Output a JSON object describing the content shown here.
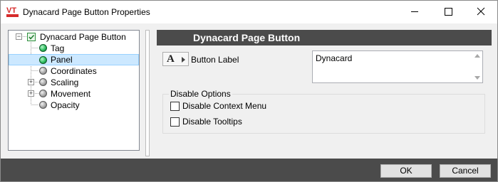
{
  "window": {
    "title": "Dynacard Page Button Properties",
    "logo_icon": "vtscada-logo-icon",
    "controls": [
      "minimize-icon",
      "maximize-icon",
      "close-icon"
    ]
  },
  "tree": {
    "root": {
      "label": "Dynacard Page Button",
      "icon": "page-button-icon",
      "expanded": true
    },
    "items": [
      {
        "label": "Tag",
        "icon": "green-ball-icon",
        "expander": false
      },
      {
        "label": "Panel",
        "icon": "green-ball-icon",
        "expander": false,
        "selected": true
      },
      {
        "label": "Coordinates",
        "icon": "gray-ball-icon",
        "expander": false
      },
      {
        "label": "Scaling",
        "icon": "gray-ball-icon",
        "expander": true
      },
      {
        "label": "Movement",
        "icon": "gray-ball-icon",
        "expander": true
      },
      {
        "label": "Opacity",
        "icon": "gray-ball-icon",
        "expander": false
      }
    ]
  },
  "panel": {
    "header": "Dynacard Page Button",
    "font_button_glyph": "A",
    "button_label": {
      "label": "Button Label",
      "value": "Dynacard"
    },
    "disable_options": {
      "title": "Disable Options",
      "options": [
        {
          "label": "Disable Context Menu",
          "checked": false
        },
        {
          "label": "Disable Tooltips",
          "checked": false
        }
      ]
    }
  },
  "footer": {
    "ok_label": "OK",
    "cancel_label": "Cancel"
  },
  "colors": {
    "header_bg": "#4b4b4b",
    "selection_bg": "#cce8ff",
    "node_active": "#2fbf62",
    "node_inactive": "#a8a8a8"
  }
}
